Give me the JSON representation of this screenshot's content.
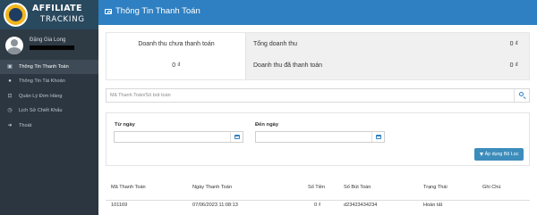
{
  "app": {
    "logo_line1": "AFFILIATE",
    "logo_line2": "TRACKING"
  },
  "user": {
    "name": "Đặng Gia Long"
  },
  "sidebar": {
    "items": [
      {
        "label": "Thông Tin Thanh Toán",
        "icon": "id-card-icon",
        "active": true
      },
      {
        "label": "Thông Tin Tài Khoản",
        "icon": "user-icon",
        "active": false
      },
      {
        "label": "Quản Lý Đơn Hàng",
        "icon": "cart-icon",
        "active": false
      },
      {
        "label": "Lịch Sử Chiết Khấu",
        "icon": "history-icon",
        "active": false
      },
      {
        "label": "Thoát",
        "icon": "logout-icon",
        "active": false
      }
    ]
  },
  "header": {
    "title": "Thông Tin Thanh Toán"
  },
  "summary": {
    "unpaid_label": "Doanh thu chưa thanh toán",
    "unpaid_value": "0 ₫",
    "total_label": "Tổng doanh thu",
    "total_value": "0 ₫",
    "paid_label": "Doanh thu đã thanh toán",
    "paid_value": "0 ₫"
  },
  "search": {
    "placeholder": "Mã Thanh Toán/Số bút toán"
  },
  "filter": {
    "from_label": "Từ ngày",
    "from_value": "",
    "to_label": "Đến ngày",
    "to_value": "",
    "apply_label": "Áp dụng Bộ Lọc"
  },
  "table": {
    "columns": [
      "Mã Thanh Toán",
      "Ngày Thanh Toán",
      "Số Tiền",
      "Số Bút Toán",
      "Trạng Thái",
      "Ghi Chú"
    ],
    "rows": [
      [
        "101169",
        "07/06/2023 11:08:13",
        "0 ₫",
        "d23423434234",
        "Hoàn tất",
        ""
      ]
    ]
  },
  "colors": {
    "header_blue": "#2f80c2",
    "sidebar_bg": "#2b3640",
    "button_blue": "#3c8dbc"
  }
}
